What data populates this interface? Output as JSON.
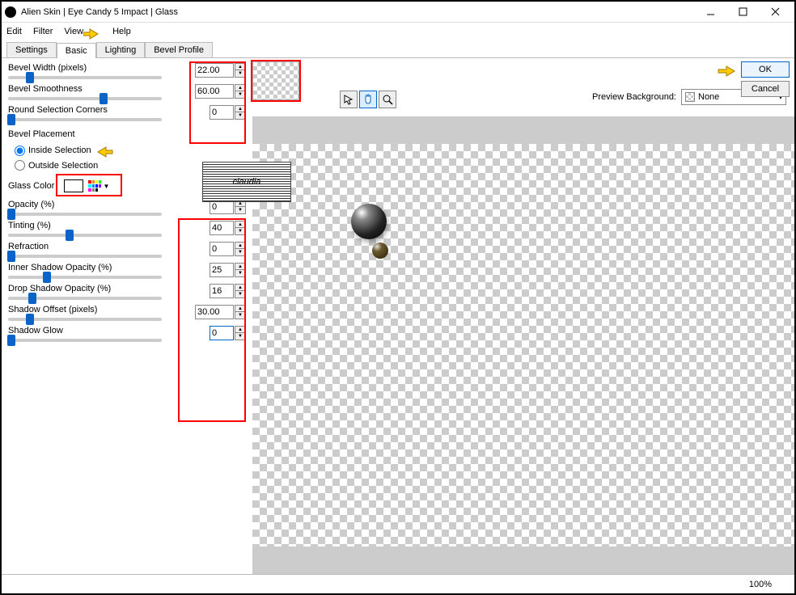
{
  "window": {
    "title": "Alien Skin | Eye Candy 5 Impact | Glass"
  },
  "menu": {
    "edit": "Edit",
    "filter": "Filter",
    "view": "View",
    "help": "Help"
  },
  "tabs": {
    "settings": "Settings",
    "basic": "Basic",
    "lighting": "Lighting",
    "bevel": "Bevel Profile"
  },
  "params": {
    "bevel_width": {
      "label": "Bevel Width (pixels)",
      "value": "22.00"
    },
    "bevel_smooth": {
      "label": "Bevel Smoothness",
      "value": "60.00"
    },
    "round_corners": {
      "label": "Round Selection Corners",
      "value": "0"
    },
    "placement": {
      "label": "Bevel Placement",
      "inside": "Inside Selection",
      "outside": "Outside Selection"
    },
    "glass_color": {
      "label": "Glass Color"
    },
    "opacity": {
      "label": "Opacity (%)",
      "value": "0"
    },
    "tinting": {
      "label": "Tinting (%)",
      "value": "40"
    },
    "refraction": {
      "label": "Refraction",
      "value": "0"
    },
    "inner_shadow": {
      "label": "Inner Shadow Opacity (%)",
      "value": "25"
    },
    "drop_shadow": {
      "label": "Drop Shadow Opacity (%)",
      "value": "16"
    },
    "shadow_offset": {
      "label": "Shadow Offset (pixels)",
      "value": "30.00"
    },
    "shadow_glow": {
      "label": "Shadow Glow",
      "value": "0"
    }
  },
  "preview": {
    "bg_label": "Preview Background:",
    "bg_value": "None"
  },
  "buttons": {
    "ok": "OK",
    "cancel": "Cancel"
  },
  "status": {
    "zoom": "100%"
  },
  "watermark": "claudia"
}
